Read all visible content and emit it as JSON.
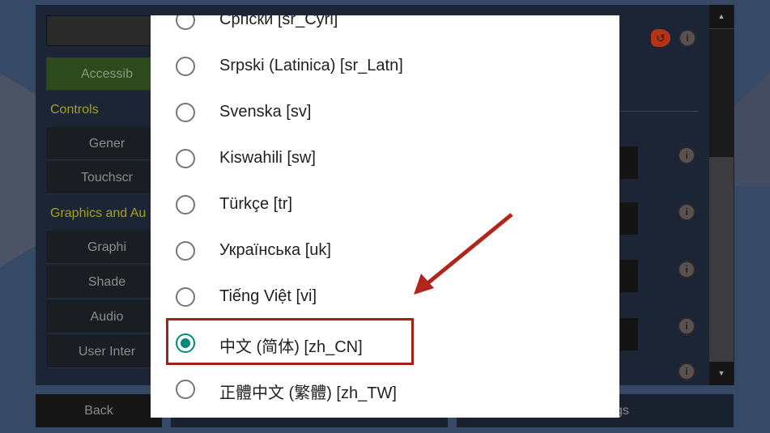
{
  "sidebar": {
    "accessibility": "Accessib",
    "controls_header": "Controls",
    "general": "Gener",
    "touchscreen": "Touchscr",
    "graphics_header": "Graphics and Au",
    "graphics": "Graphi",
    "shaders": "Shade",
    "audio": "Audio",
    "user_interface": "User Inter"
  },
  "bottom": {
    "back": "Back",
    "middle": "",
    "right": "gs"
  },
  "dialog": {
    "items": [
      {
        "label": "Српски [sr_Cyrl]",
        "selected": false
      },
      {
        "label": "Srpski (Latinica) [sr_Latn]",
        "selected": false
      },
      {
        "label": "Svenska [sv]",
        "selected": false
      },
      {
        "label": "Kiswahili [sw]",
        "selected": false
      },
      {
        "label": "Türkçe [tr]",
        "selected": false
      },
      {
        "label": "Українська [uk]",
        "selected": false
      },
      {
        "label": "Tiếng Việt [vi]",
        "selected": false
      },
      {
        "label": "中文 (简体) [zh_CN]",
        "selected": true
      },
      {
        "label": "正體中文 (繁體) [zh_TW]",
        "selected": false
      }
    ]
  },
  "colors": {
    "accent": "#00897b",
    "annotation": "#a32217"
  },
  "icons": {
    "info": "info-icon",
    "reset": "reset-icon"
  }
}
